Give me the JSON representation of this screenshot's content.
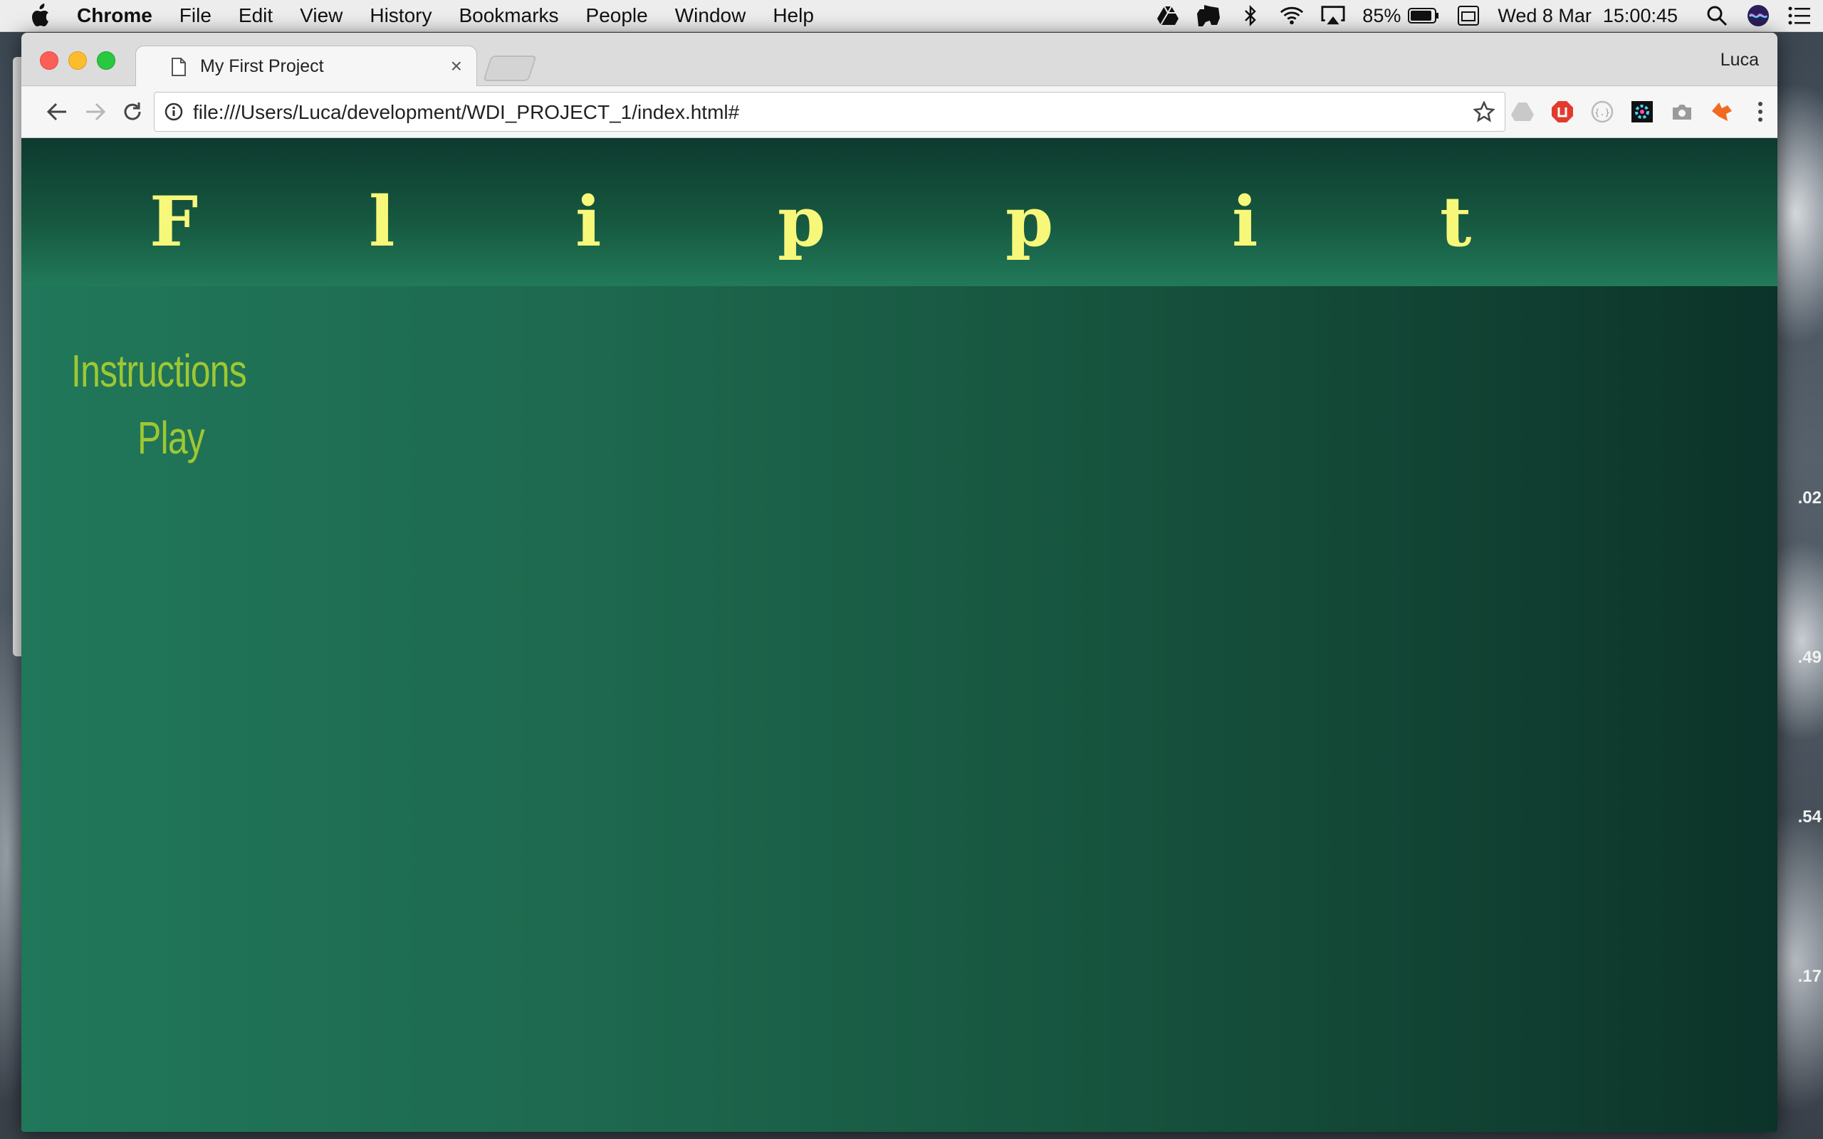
{
  "menubar": {
    "app_name": "Chrome",
    "items": [
      "File",
      "Edit",
      "View",
      "History",
      "Bookmarks",
      "People",
      "Window",
      "Help"
    ],
    "battery": "85%",
    "date": "Wed 8 Mar",
    "time": "15:00:45"
  },
  "desktop": {
    "side_numbers": [
      ".02",
      ".49",
      ".54",
      ".17"
    ]
  },
  "browser": {
    "tab_title": "My First Project",
    "tab_close": "×",
    "profile_name": "Luca",
    "url": "file:///Users/Luca/development/WDI_PROJECT_1/index.html#"
  },
  "page": {
    "title_letters": [
      "F",
      "l",
      "i",
      "p",
      "p",
      "i",
      "t"
    ],
    "menu": {
      "instructions": "Instructions",
      "play": "Play"
    },
    "colors": {
      "title": "#f7f77a",
      "menu": "#9ec832",
      "background": "#1c6a4e"
    }
  }
}
